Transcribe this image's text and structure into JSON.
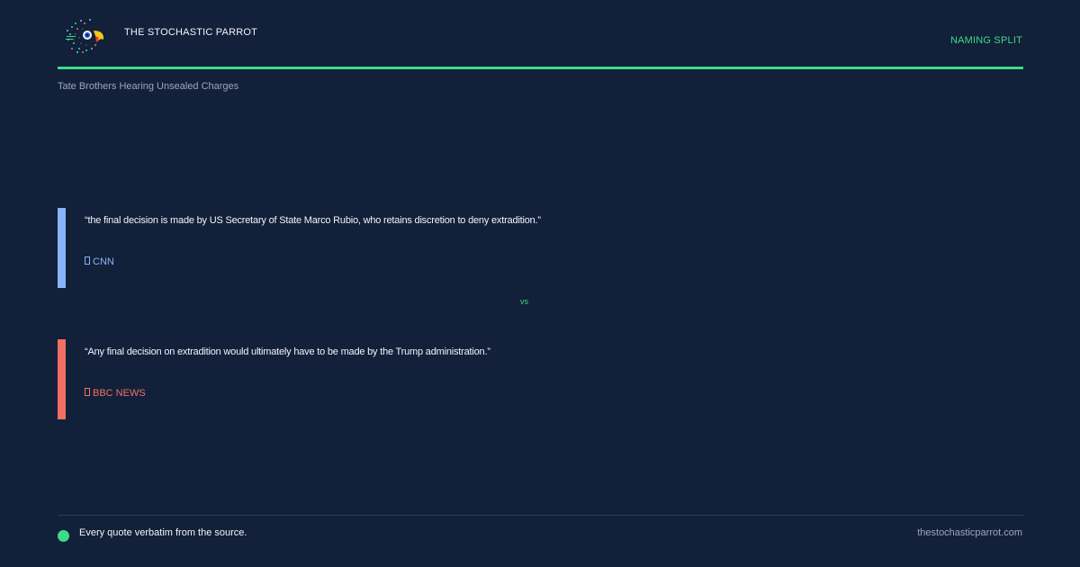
{
  "header": {
    "brand": "THE STOCHASTIC PARROT",
    "tag": "NAMING SPLIT"
  },
  "subtitle": "Tate Brothers Hearing Unsealed Charges",
  "quotes": [
    {
      "text": "“the final decision is made by US Secretary of State Marco Rubio, who retains discretion to deny extradition.”",
      "source": "CNN",
      "color": "#8ab4f8"
    },
    {
      "text": "“Any final decision on extradition would ultimately have to be made by the Trump administration.”",
      "source": "BBC NEWS",
      "color": "#f07163"
    }
  ],
  "vs_label": "vs",
  "footer": {
    "note": "Every quote verbatim from the source.",
    "url": "thestochasticparrot.com"
  },
  "colors": {
    "background": "#12203a",
    "accent": "#3ddc84"
  },
  "icons": {
    "logo": "parrot-logo-icon",
    "source": "document-icon",
    "status": "status-dot-icon"
  }
}
